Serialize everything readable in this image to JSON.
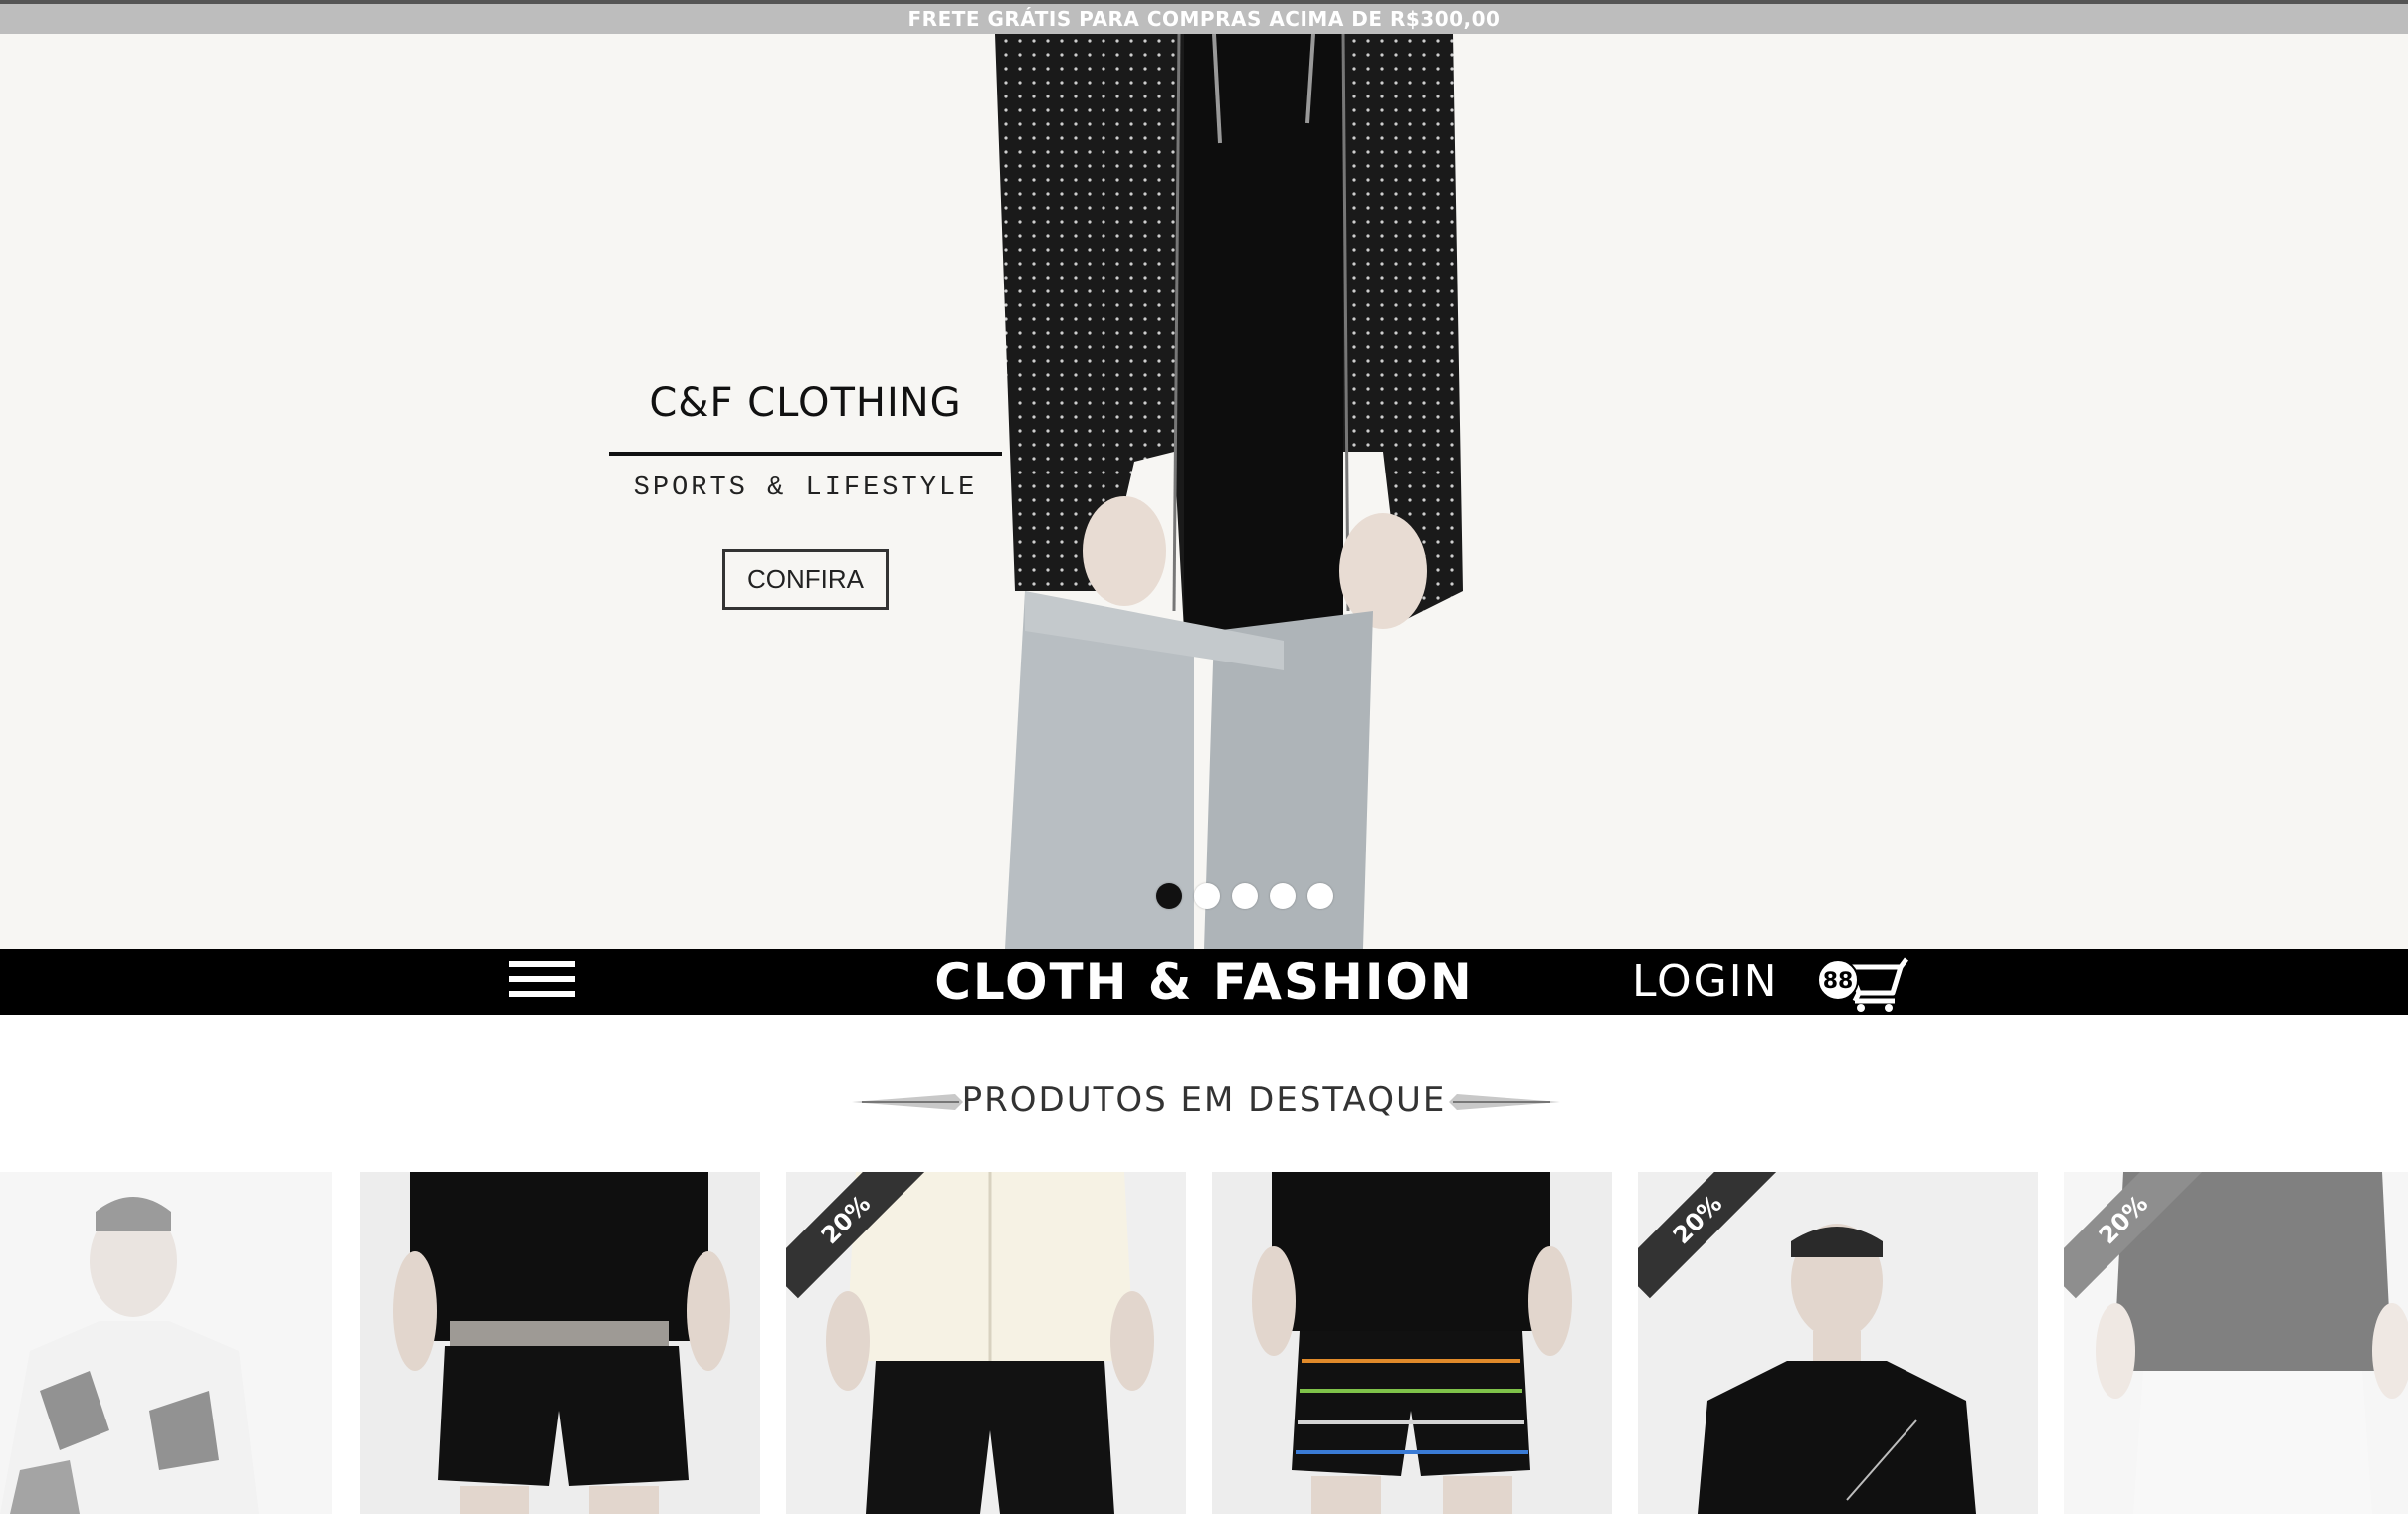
{
  "promo": {
    "text": "FRETE GRÁTIS PARA COMPRAS ACIMA DE R$300,00"
  },
  "hero": {
    "title": "C&F CLOTHING",
    "subtitle": "SPORTS & LIFESTYLE",
    "cta_label": "CONFIRA",
    "slides": {
      "count": 5,
      "active_index": 0
    }
  },
  "navbar": {
    "menu_icon": "hamburger-menu-icon",
    "brand": "CLOTH & FASHION",
    "login_label": "LOGIN",
    "cart_count": "88",
    "cart_icon": "shopping-cart-icon"
  },
  "featured": {
    "title": "PRODUTOS EM DESTAQUE",
    "products": [
      {
        "name": "patterned-shirt",
        "badge": "",
        "faded": true
      },
      {
        "name": "black-shorts",
        "badge": ""
      },
      {
        "name": "cream-shirt",
        "badge": "20%"
      },
      {
        "name": "striped-shorts",
        "badge": ""
      },
      {
        "name": "black-tshirt",
        "badge": "20%"
      },
      {
        "name": "black-shirt",
        "badge": "20%",
        "faded": true
      }
    ]
  },
  "colors": {
    "promo_bg": "#bdbdbd",
    "navbar_bg": "#000000",
    "hero_bg": "#f7f6f3",
    "accent": "#111111"
  }
}
